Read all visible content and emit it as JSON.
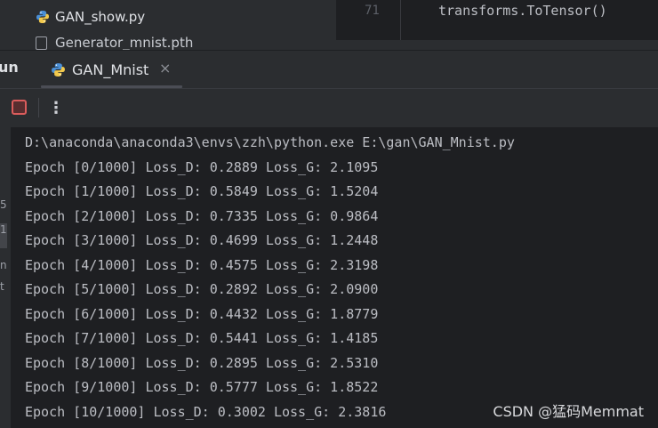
{
  "project_tree": {
    "items": [
      {
        "label": "GAN_show.py",
        "icon": "python-icon"
      },
      {
        "label": "Generator_mnist.pth",
        "icon": "file-icon"
      }
    ]
  },
  "editor": {
    "line_number": "71",
    "code": "transforms.ToTensor()"
  },
  "tool_window": {
    "title": "un",
    "tab": {
      "label": "GAN_Mnist",
      "close": "×"
    },
    "more_label": "⋮"
  },
  "console": {
    "lines": [
      "D:\\anaconda\\anaconda3\\envs\\zzh\\python.exe E:\\gan\\GAN_Mnist.py",
      "Epoch [0/1000] Loss_D: 0.2889 Loss_G: 2.1095",
      "Epoch [1/1000] Loss_D: 0.5849 Loss_G: 1.5204",
      "Epoch [2/1000] Loss_D: 0.7335 Loss_G: 0.9864",
      "Epoch [3/1000] Loss_D: 0.4699 Loss_G: 1.2448",
      "Epoch [4/1000] Loss_D: 0.4575 Loss_G: 2.3198",
      "Epoch [5/1000] Loss_D: 0.2892 Loss_G: 2.0900",
      "Epoch [6/1000] Loss_D: 0.4432 Loss_G: 1.8779",
      "Epoch [7/1000] Loss_D: 0.5441 Loss_G: 1.4185",
      "Epoch [8/1000] Loss_D: 0.2895 Loss_G: 2.5310",
      "Epoch [9/1000] Loss_D: 0.5777 Loss_G: 1.8522",
      "Epoch [10/1000] Loss_D: 0.3002 Loss_G: 2.3816"
    ],
    "side_glyphs": [
      "5",
      "1",
      "n",
      "t"
    ]
  },
  "watermark": "CSDN @猛码Memmat",
  "colors": {
    "background": "#1e1f22",
    "panel": "#2b2d30",
    "stop": "#db5c5c"
  }
}
